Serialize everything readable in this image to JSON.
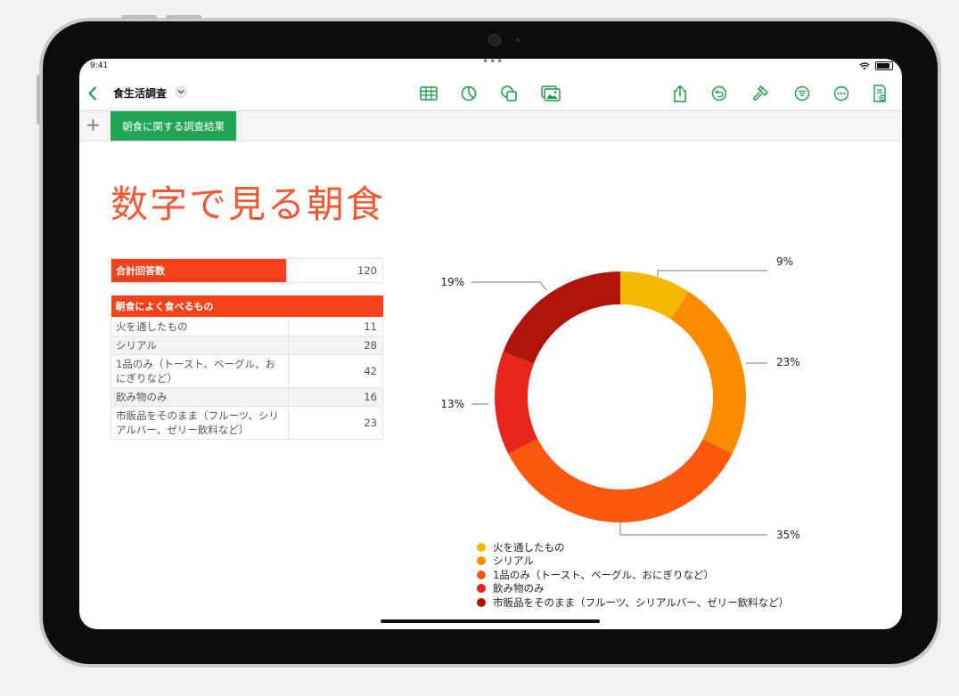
{
  "status_bar": {
    "time": "9:41"
  },
  "toolbar": {
    "document_title": "食生活調査"
  },
  "sheets": {
    "active_tab": "朝食に関する調査結果"
  },
  "page": {
    "title": "数字で見る朝食"
  },
  "total_table": {
    "label": "合計回答数",
    "value": "120"
  },
  "breakfast_table": {
    "header": "朝食によく食べるもの",
    "rows": [
      {
        "label": "火を通したもの",
        "value": "11"
      },
      {
        "label": "シリアル",
        "value": "28"
      },
      {
        "label": "1品のみ（トースト、ベーグル、おにぎりなど）",
        "value": "42"
      },
      {
        "label": "飲み物のみ",
        "value": "16"
      },
      {
        "label": "市販品をそのまま（フルーツ、シリアルバー、ゼリー飲料など）",
        "value": "23"
      }
    ]
  },
  "chart_data": {
    "type": "pie",
    "style": "donut",
    "categories": [
      "火を通したもの",
      "シリアル",
      "1品のみ（トースト、ベーグル、おにぎりなど）",
      "飲み物のみ",
      "市販品をそのまま（フルーツ、シリアルバー、ゼリー飲料など）"
    ],
    "values": [
      11,
      28,
      42,
      16,
      23
    ],
    "percent_labels": [
      "9%",
      "23%",
      "35%",
      "13%",
      "19%"
    ],
    "colors": [
      "#f6b700",
      "#fb8c00",
      "#fb5a0e",
      "#e8251a",
      "#b01509"
    ],
    "legend_position": "bottom",
    "title": ""
  }
}
